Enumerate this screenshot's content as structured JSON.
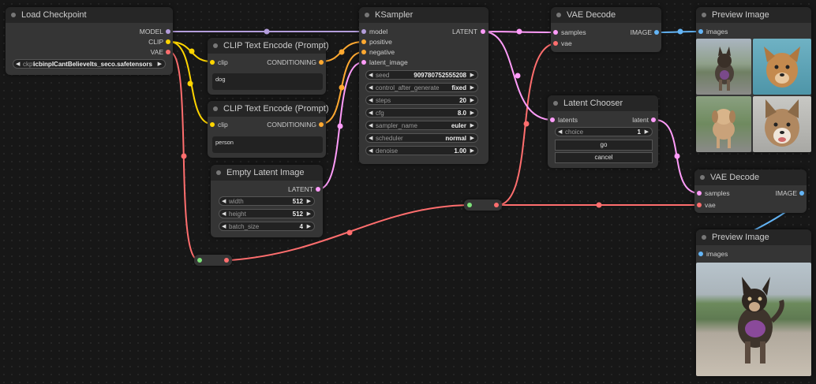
{
  "colors": {
    "model": "#b39ddb",
    "clip": "#ffd500",
    "vae": "#ff6e6e",
    "conditioning": "#ffa931",
    "latent": "#ff9cf9",
    "image": "#64b5f6",
    "reroute_in": "#7ee37a"
  },
  "nodes": {
    "load_checkpoint": {
      "title": "Load Checkpoint",
      "outputs": [
        "MODEL",
        "CLIP",
        "VAE"
      ],
      "ckpt_label": "ckpt",
      "ckpt_value": "icbinpICantBelieveIts_seco.safetensors"
    },
    "clip_text_1": {
      "title": "CLIP Text Encode (Prompt)",
      "input": "clip",
      "output": "CONDITIONING",
      "text": "dog"
    },
    "clip_text_2": {
      "title": "CLIP Text Encode (Prompt)",
      "input": "clip",
      "output": "CONDITIONING",
      "text": "person"
    },
    "empty_latent": {
      "title": "Empty Latent Image",
      "output": "LATENT",
      "widgets": [
        {
          "label": "width",
          "value": "512"
        },
        {
          "label": "height",
          "value": "512"
        },
        {
          "label": "batch_size",
          "value": "4"
        }
      ]
    },
    "ksampler": {
      "title": "KSampler",
      "inputs": [
        "model",
        "positive",
        "negative",
        "latent_image"
      ],
      "output": "LATENT",
      "widgets": [
        {
          "label": "seed",
          "value": "909780752555208"
        },
        {
          "label": "control_after_generate",
          "value": "fixed"
        },
        {
          "label": "steps",
          "value": "20"
        },
        {
          "label": "cfg",
          "value": "8.0"
        },
        {
          "label": "sampler_name",
          "value": "euler"
        },
        {
          "label": "scheduler",
          "value": "normal"
        },
        {
          "label": "denoise",
          "value": "1.00"
        }
      ]
    },
    "vae_decode_1": {
      "title": "VAE Decode",
      "inputs": [
        "samples",
        "vae"
      ],
      "output": "IMAGE"
    },
    "latent_chooser": {
      "title": "Latent Chooser",
      "input": "latents",
      "output": "latent",
      "choice_label": "choice",
      "choice_value": "1",
      "go_label": "go",
      "cancel_label": "cancel"
    },
    "preview_1": {
      "title": "Preview Image",
      "input": "images"
    },
    "vae_decode_2": {
      "title": "VAE Decode",
      "inputs": [
        "samples",
        "vae"
      ],
      "output": "IMAGE"
    },
    "preview_2": {
      "title": "Preview Image",
      "input": "images"
    }
  },
  "icons": {
    "widget_left": "triangle-left-icon",
    "widget_right": "triangle-right-icon",
    "node_dot": "collapse-dot-icon"
  }
}
